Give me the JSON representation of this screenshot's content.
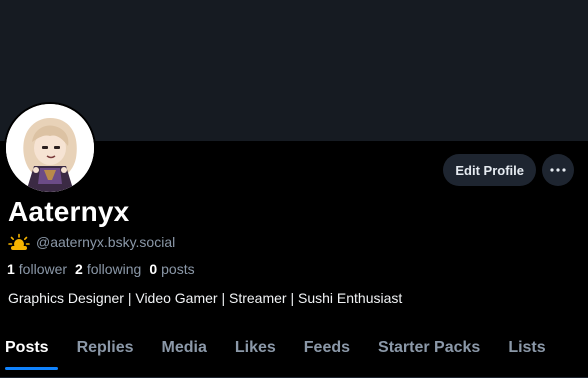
{
  "profile": {
    "display_name": "Aaternyx",
    "handle": "@aaternyx.bsky.social",
    "emoji_icon": "sun-behind-cloud-icon",
    "bio": "Graphics Designer | Video Gamer | Streamer | Sushi Enthusiast",
    "avatar_icon": "anime-avatar-image"
  },
  "stats": {
    "followers_count": "1",
    "followers_label": "follower",
    "following_count": "2",
    "following_label": "following",
    "posts_count": "0",
    "posts_label": "posts"
  },
  "actions": {
    "edit_profile_label": "Edit Profile",
    "more_icon": "ellipsis-icon"
  },
  "tabs": [
    {
      "label": "Posts",
      "active": true
    },
    {
      "label": "Replies",
      "active": false
    },
    {
      "label": "Media",
      "active": false
    },
    {
      "label": "Likes",
      "active": false
    },
    {
      "label": "Feeds",
      "active": false
    },
    {
      "label": "Starter Packs",
      "active": false
    },
    {
      "label": "Lists",
      "active": false
    }
  ],
  "colors": {
    "banner": "#161b22",
    "background": "#000000",
    "accent": "#1083fe",
    "muted_text": "#8b98a8",
    "button_bg": "#1e2530"
  }
}
